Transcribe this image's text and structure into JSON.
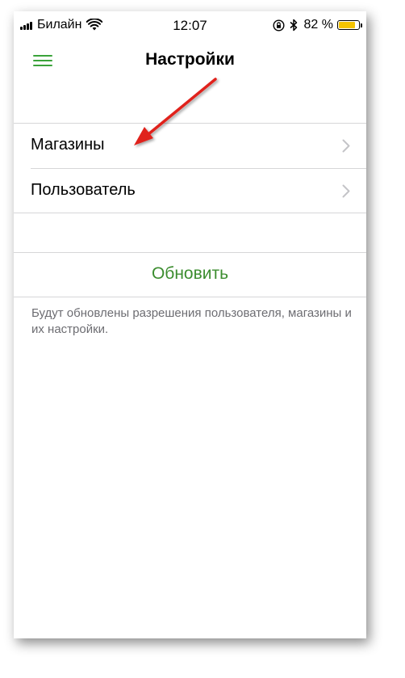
{
  "status_bar": {
    "carrier": "Билайн",
    "time": "12:07",
    "battery_percent": "82 %",
    "battery_level": 0.82,
    "icons": [
      "signal-icon",
      "wifi-icon",
      "orientation-lock-icon",
      "bluetooth-icon",
      "battery-icon"
    ]
  },
  "nav": {
    "title": "Настройки",
    "menu_icon": "hamburger-menu-icon"
  },
  "settings": {
    "items": [
      {
        "label": "Магазины",
        "icon": "chevron-right-icon"
      },
      {
        "label": "Пользователь",
        "icon": "chevron-right-icon"
      }
    ]
  },
  "refresh": {
    "label": "Обновить",
    "description": "Будут обновлены разрешения пользователя, магазины и их настройки."
  },
  "colors": {
    "accent_green": "#3aa33a",
    "refresh_text": "#3c8d2f",
    "annotation_arrow": "#e0201b",
    "battery": "#f5c400"
  }
}
